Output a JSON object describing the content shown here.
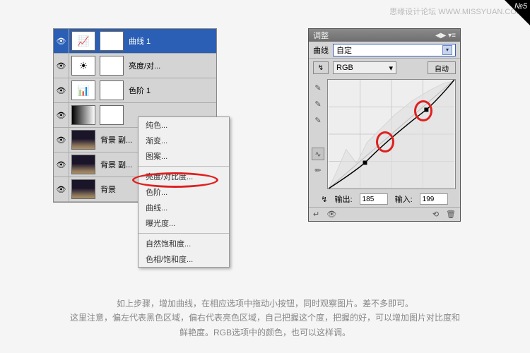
{
  "watermark": "思缘设计论坛  WWW.MISSYUAN.COM",
  "badge": "№5",
  "layers": [
    {
      "label": "曲线 1",
      "selected": true,
      "type": "curves"
    },
    {
      "label": "亮度/对...",
      "type": "brightness"
    },
    {
      "label": "色阶 1",
      "type": "levels"
    },
    {
      "label": "",
      "type": "gradient"
    },
    {
      "label": "背景 副...",
      "type": "photo"
    },
    {
      "label": "背景 副...",
      "type": "photo"
    },
    {
      "label": "背景",
      "type": "photo"
    }
  ],
  "menu": {
    "group1": [
      "纯色...",
      "渐变...",
      "图案..."
    ],
    "group2": [
      "亮度/对比度...",
      "色阶...",
      "曲线...",
      "曝光度..."
    ],
    "group3": [
      "自然饱和度...",
      "色相/饱和度..."
    ]
  },
  "adj": {
    "title": "调整",
    "preset_label": "曲线",
    "preset_value": "自定",
    "channel": "RGB",
    "auto": "自动",
    "out_label": "输出:",
    "out_value": "185",
    "in_label": "输入:",
    "in_value": "199",
    "tools": [
      "✎",
      "✎",
      "✎"
    ],
    "sidetools": [
      "∿",
      "☀",
      "⌖"
    ]
  },
  "caption": {
    "l1": "如上步骤，增加曲线，在相应选项中拖动小按钮，同时观察图片。差不多即可。",
    "l2": "这里注意，偏左代表黑色区域，偏右代表亮色区域，自己把握这个度，把握的好，可以增加图片对比度和",
    "l3": "鲜艳度。RGB选项中的颜色，也可以这样调。"
  },
  "chart_data": {
    "type": "line",
    "title": "Curves",
    "xlabel": "Input",
    "ylabel": "Output",
    "xlim": [
      0,
      255
    ],
    "ylim": [
      0,
      255
    ],
    "control_points": [
      {
        "x": 0,
        "y": 0
      },
      {
        "x": 74,
        "y": 60
      },
      {
        "x": 199,
        "y": 185
      },
      {
        "x": 255,
        "y": 255
      }
    ],
    "diagonal": true,
    "histogram": true
  }
}
